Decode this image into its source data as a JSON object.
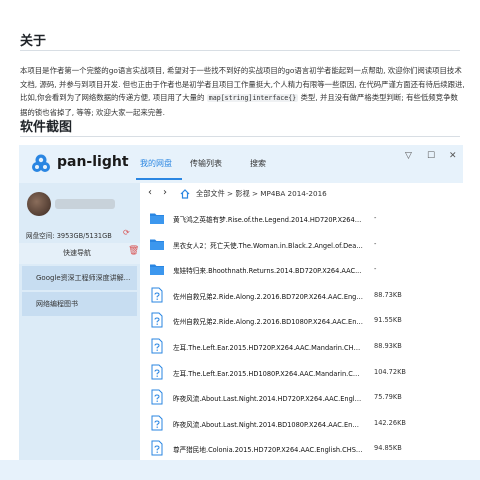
{
  "readme": {
    "about_heading": "关于",
    "about_text_1": "本项目是作者第一个完整的go语言实战项目, 希望对于一些找不到好的实战项目的go语言初学者能起到一点帮助, 欢迎你们阅读项目技术文档, 源码, 并参与到项目开发. 但也正由于作者也是初学者且项目工作量挺大,个人精力有限等一些原因, 在代码严谨方面还有待后续跟进, 比如,你会看到为了网络数据的传递方便, 项目用了大量的",
    "about_code": "map[string]interface{}",
    "about_text_2": "类型, 并且没有做严格类型判断; 有些低频竞争数据的锁也省掉了, 等等; 欢迎大家一起来完善.",
    "screenshot_heading": "软件截图"
  },
  "app": {
    "name": "pan-light",
    "tabs": [
      {
        "label": "我的网盘",
        "active": true
      },
      {
        "label": "传输列表",
        "active": false
      },
      {
        "label": "搜索",
        "active": false
      }
    ],
    "window_buttons": {
      "collapse": "▽",
      "maximize": "☐",
      "close": "✕"
    },
    "sidebar": {
      "storage": "网盘空间: 3953GB/5131GB",
      "nav_title": "快速导航",
      "favorites": [
        "Google资深工程师深度讲解...",
        "网络编程图书"
      ]
    },
    "path": {
      "back": "‹",
      "forward": "›",
      "crumbs": "全部文件 > 影视 > MP4BA 2014-2016"
    },
    "files": [
      {
        "name": "黄飞鸿之英雄有梦.Rise.of.the.Legend.2014.HD720P.X264.AAC...",
        "size": "-",
        "type": "folder"
      },
      {
        "name": "黑衣女人2：死亡天使.The.Woman.in.Black.2.Angel.of.Death...",
        "size": "-",
        "type": "folder"
      },
      {
        "name": "鬼娃特归来.Bhoothnath.Returns.2014.BD720P.X264.AAC...",
        "size": "-",
        "type": "folder"
      },
      {
        "name": "佐州自救兄弟2.Ride.Along.2.2016.BD720P.X264.AAC.English.C...",
        "size": "88.73KB",
        "type": "file"
      },
      {
        "name": "佐州自救兄弟2.Ride.Along.2.2016.BD1080P.X264.AAC.English...",
        "size": "91.55KB",
        "type": "file"
      },
      {
        "name": "左耳.The.Left.Ear.2015.HD720P.X264.AAC.Mandarin.CHS.Mp4B...",
        "size": "88.93KB",
        "type": "file"
      },
      {
        "name": "左耳.The.Left.Ear.2015.HD1080P.X264.AAC.Mandarin.CHS.Mp4...",
        "size": "104.72KB",
        "type": "file"
      },
      {
        "name": "昨夜风流.About.Last.Night.2014.HD720P.X264.AAC.English.CHS...",
        "size": "75.79KB",
        "type": "file"
      },
      {
        "name": "昨夜风流.About.Last.Night.2014.BD1080P.X264.AAC.English.CHS...",
        "size": "142.26KB",
        "type": "file"
      },
      {
        "name": "尊严猎民地.Colonia.2015.HD720P.X264.AAC.English.CHS-ENG.Mp4...",
        "size": "94.85KB",
        "type": "file"
      }
    ]
  },
  "colors": {
    "accent": "#2a86e2",
    "folder": "#2a86e2",
    "header_bg": "#e7f2fb",
    "sidebar_bg": "#dcebf7"
  }
}
